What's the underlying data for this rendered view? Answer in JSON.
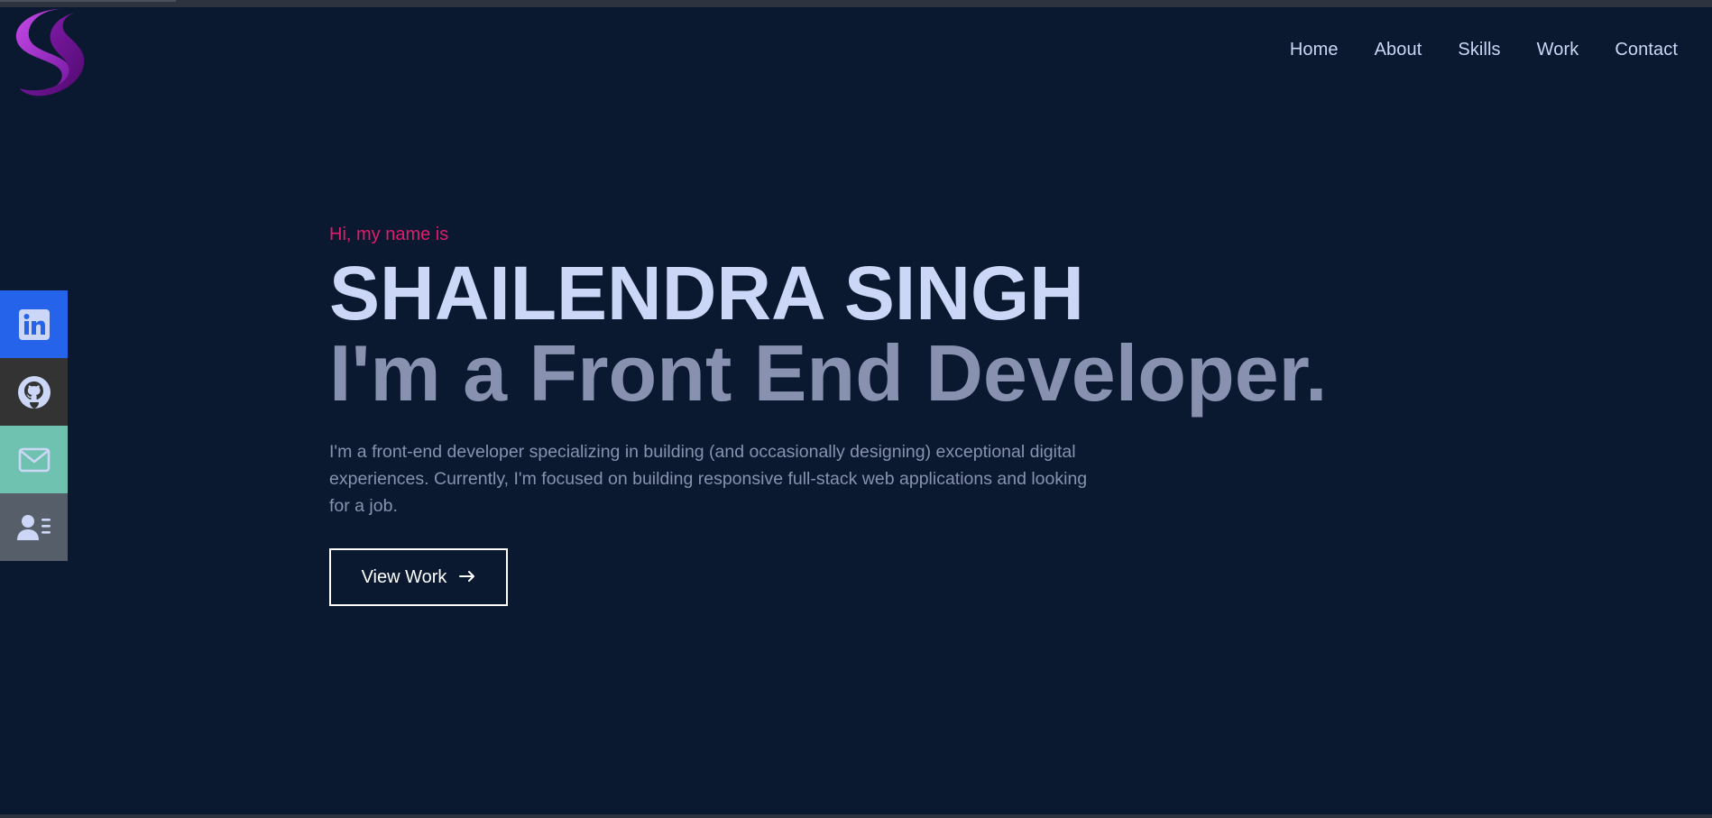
{
  "brand": {
    "logo_icon": "s-monogram-logo-icon",
    "colors": {
      "logo_light": "#b33bd9",
      "logo_dark": "#6b0f8f"
    }
  },
  "nav": {
    "items": [
      {
        "label": "Home"
      },
      {
        "label": "About"
      },
      {
        "label": "Skills"
      },
      {
        "label": "Work"
      },
      {
        "label": "Contact"
      }
    ]
  },
  "social": {
    "items": [
      {
        "icon": "linkedin-icon",
        "color": "#2563eb"
      },
      {
        "icon": "github-icon",
        "color": "#333333"
      },
      {
        "icon": "mail-icon",
        "color": "#6fc2b0"
      },
      {
        "icon": "resume-contact-card-icon",
        "color": "#565f69"
      }
    ]
  },
  "hero": {
    "greeting": "Hi, my name is",
    "name": "SHAILENDRA SINGH",
    "tagline": "I'm a Front End Developer.",
    "intro": "I'm a front-end developer specializing in building (and occasionally designing) exceptional digital experiences. Currently, I'm focused on building responsive full-stack web applications and looking for a job.",
    "cta_label": "View Work",
    "cta_icon": "arrow-right-icon"
  },
  "colors": {
    "background": "#0a192f",
    "accent": "#e31b6d",
    "heading": "#ccd6f6",
    "muted": "#8892b0"
  }
}
